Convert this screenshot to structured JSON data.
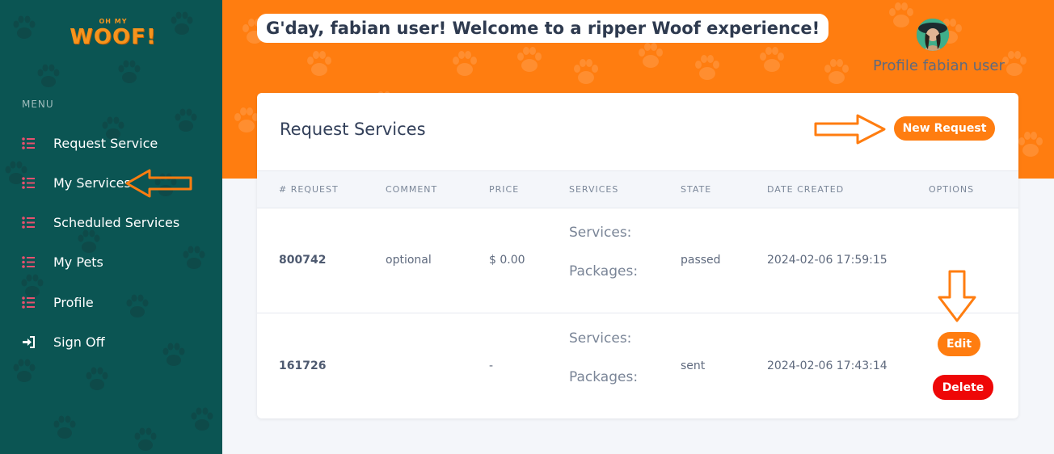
{
  "brand": {
    "logo_small": "OH MY",
    "logo_big": "WOOF!",
    "accent": "#ff7d10",
    "sidebar_bg": "#0b5553"
  },
  "sidebar": {
    "menu_title": "MENU",
    "items": [
      {
        "label": "Request Service",
        "icon": "list-icon"
      },
      {
        "label": "My Services",
        "icon": "list-icon"
      },
      {
        "label": "Scheduled Services",
        "icon": "list-icon"
      },
      {
        "label": "My Pets",
        "icon": "list-icon"
      },
      {
        "label": "Profile",
        "icon": "list-icon"
      },
      {
        "label": "Sign Off",
        "icon": "sign-in-icon"
      }
    ]
  },
  "header": {
    "greeting": "G'day, fabian user! Welcome to a ripper Woof experience!",
    "profile_name": "Profile fabian user"
  },
  "card": {
    "title": "Request Services",
    "new_request_label": "New Request",
    "columns": [
      "# REQUEST",
      "COMMENT",
      "PRICE",
      "SERVICES",
      "STATE",
      "DATE CREATED",
      "OPTIONS"
    ],
    "rows": [
      {
        "request": "800742",
        "comment": "optional",
        "price": "$ 0.00",
        "services_label": "Services:",
        "packages_label": "Packages:",
        "state": "passed",
        "date": "2024-02-06 17:59:15"
      },
      {
        "request": "161726",
        "comment": "",
        "price": "-",
        "services_label": "Services:",
        "packages_label": "Packages:",
        "state": "sent",
        "date": "2024-02-06 17:43:14",
        "edit_label": "Edit",
        "delete_label": "Delete"
      }
    ]
  }
}
